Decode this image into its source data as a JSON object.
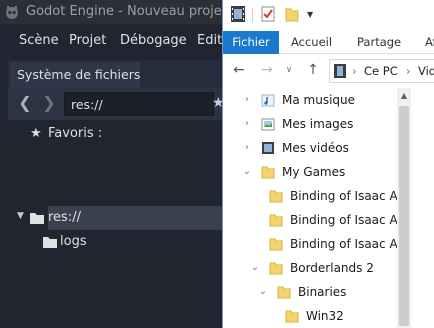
{
  "godot": {
    "window_title": "Godot Engine - Nouveau projet de jeu",
    "menu": [
      "Scène",
      "Projet",
      "Débogage",
      "Edit"
    ],
    "dock": {
      "tab_label": "Système de fichiers",
      "path_value": "res://",
      "tree": {
        "favorites_label": "Favoris :",
        "root_label": "res://",
        "child_label": "logs"
      }
    },
    "colors": {
      "background": "#202531",
      "selection": "#3a404d",
      "folder_icon": "#e0e0e0"
    }
  },
  "explorer": {
    "qat_icons": [
      "save-icon",
      "properties-check-icon",
      "new-folder-icon",
      "customize-dropdown-icon"
    ],
    "ribbon_tabs": [
      "Fichier",
      "Accueil",
      "Partage",
      "Af"
    ],
    "address": {
      "crumbs": [
        "Ce PC",
        "Vid"
      ],
      "separator": "›"
    },
    "tree": [
      {
        "label": "Ma musique",
        "icon": "music-folder-icon",
        "expanded": false
      },
      {
        "label": "Mes images",
        "icon": "pictures-folder-icon",
        "expanded": false
      },
      {
        "label": "Mes vidéos",
        "icon": "videos-folder-icon",
        "expanded": false
      },
      {
        "label": "My Games",
        "icon": "folder-icon",
        "expanded": true
      },
      {
        "label": "Binding of Isaac Afte",
        "icon": "folder-icon"
      },
      {
        "label": "Binding of Isaac Afte",
        "icon": "folder-icon"
      },
      {
        "label": "Binding of Isaac Afte",
        "icon": "folder-icon"
      },
      {
        "label": "Borderlands 2",
        "icon": "folder-icon",
        "expanded": true
      },
      {
        "label": "Binaries",
        "icon": "folder-icon",
        "expanded": true
      },
      {
        "label": "Win32",
        "icon": "folder-icon"
      }
    ],
    "colors": {
      "fichier_tab": "#1979ca",
      "folder": "#f5d36b"
    }
  }
}
